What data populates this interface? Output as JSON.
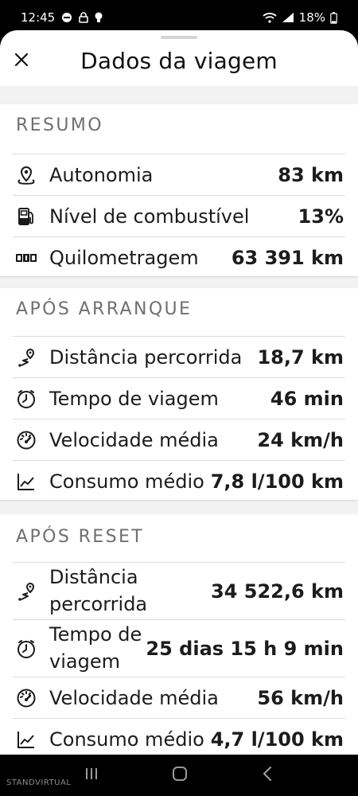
{
  "status_bar": {
    "time": "12:45",
    "battery": "18%",
    "icons": [
      "notification-icon",
      "lock-icon",
      "bulb-icon",
      "wifi-icon",
      "signal-icon",
      "battery-icon"
    ]
  },
  "header": {
    "title": "Dados da viagem",
    "close_icon": "close-icon"
  },
  "resumo": {
    "title": "RESUMO",
    "rows": [
      {
        "icon": "location-pin-icon",
        "label": "Autonomia",
        "value": "83 km"
      },
      {
        "icon": "fuel-pump-icon",
        "label": "Nível de combustível",
        "value": "13%"
      },
      {
        "icon": "odometer-icon",
        "label": "Quilometragem",
        "value": "63 391 km"
      }
    ]
  },
  "apos_arranque": {
    "title": "APÓS ARRANQUE",
    "rows": [
      {
        "icon": "route-icon",
        "label": "Distância percorrida",
        "value": "18,7 km"
      },
      {
        "icon": "clock-icon",
        "label": "Tempo de viagem",
        "value": "46 min"
      },
      {
        "icon": "speedometer-icon",
        "label": "Velocidade média",
        "value": "24 km/h"
      },
      {
        "icon": "chart-line-icon",
        "label": "Consumo médio",
        "value": "7,8 l/100 km"
      }
    ]
  },
  "apos_reset": {
    "title": "APÓS RESET",
    "rows": [
      {
        "icon": "route-icon",
        "label_line1": "Distância",
        "label_line2": "percorrida",
        "value": "34 522,6 km"
      },
      {
        "icon": "clock-icon",
        "label_line1": "Tempo de",
        "label_line2": "viagem",
        "value": "25 dias 15 h 9 min"
      },
      {
        "icon": "speedometer-icon",
        "label": "Velocidade média",
        "value": "56 km/h"
      },
      {
        "icon": "chart-line-icon",
        "label": "Consumo médio",
        "value": "4,7 l/100 km"
      }
    ]
  },
  "nav_bar": {
    "buttons": [
      "recent-apps-icon",
      "home-icon",
      "back-icon"
    ]
  },
  "watermark": "STANDVIRTUAL"
}
